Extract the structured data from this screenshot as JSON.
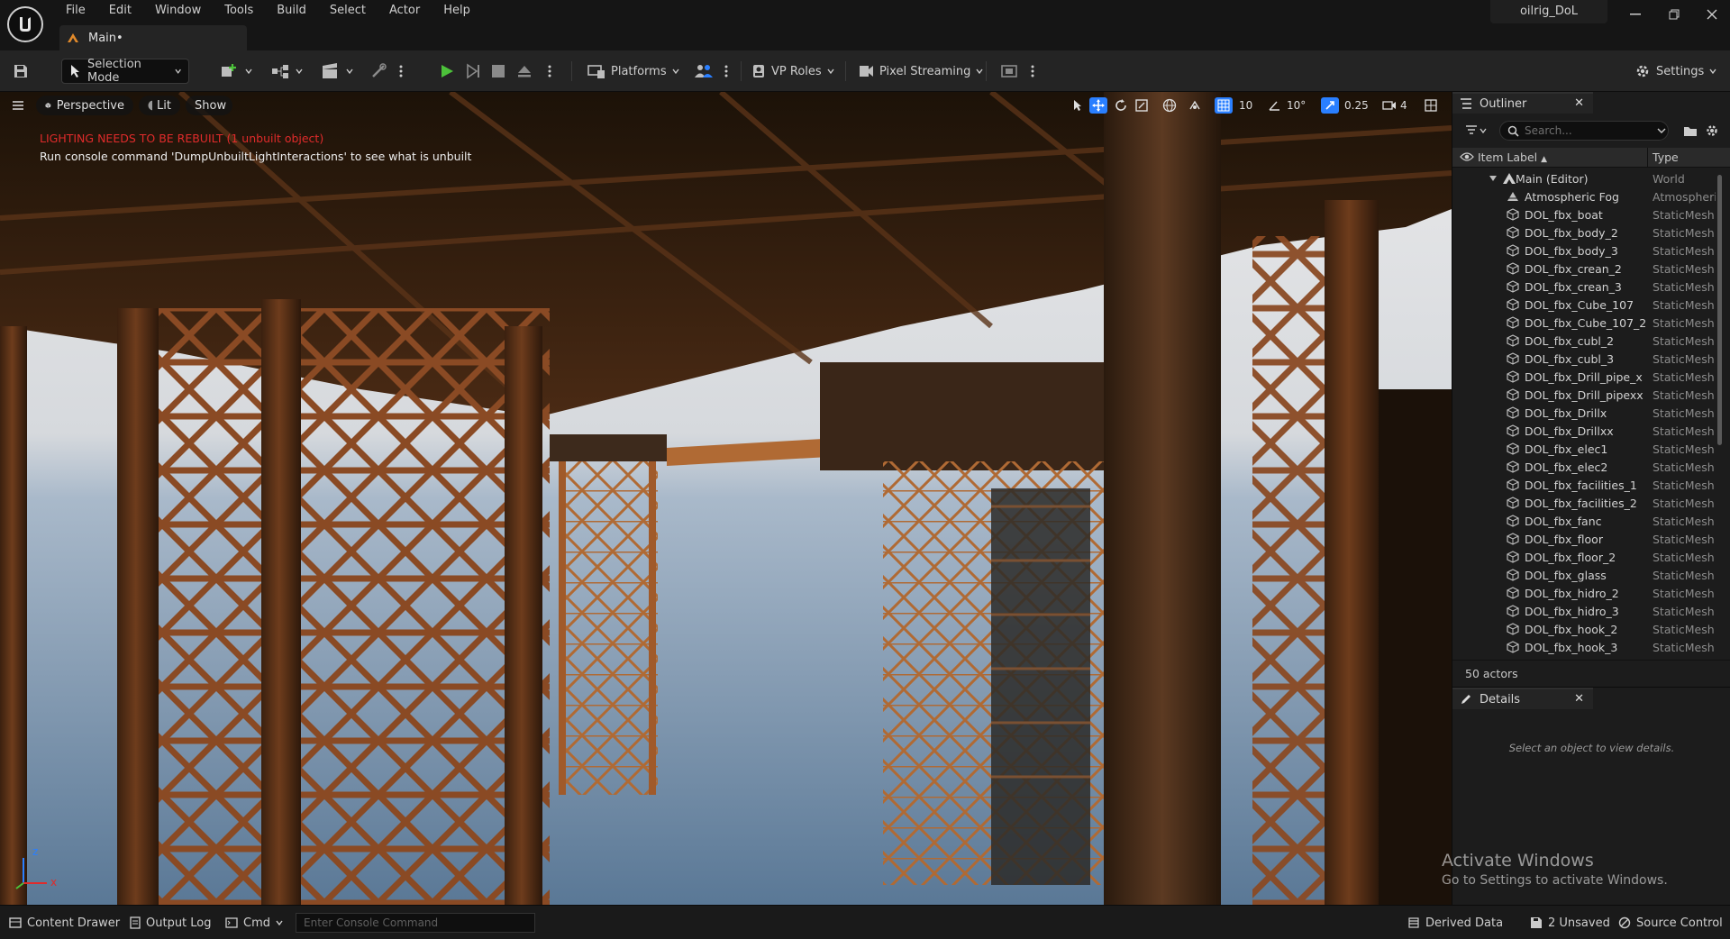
{
  "menu": [
    "File",
    "Edit",
    "Window",
    "Tools",
    "Build",
    "Select",
    "Actor",
    "Help"
  ],
  "document_tab": "Main•",
  "project_name": "oilrig_DoL",
  "toolbar": {
    "selection_mode": "Selection Mode",
    "platforms": "Platforms",
    "vp_roles": "VP Roles",
    "pixel_streaming": "Pixel Streaming",
    "settings": "Settings"
  },
  "viewport": {
    "perspective": "Perspective",
    "lit": "Lit",
    "show": "Show",
    "grid_snap": "10",
    "rotation_snap": "10°",
    "scale_snap": "0.25",
    "camera_speed": "4",
    "warning": "LIGHTING NEEDS TO BE REBUILT (1 unbuilt object)",
    "hint": "Run console command 'DumpUnbuiltLightInteractions' to see what is unbuilt",
    "axis_z": "z",
    "axis_x": "x"
  },
  "outliner": {
    "title": "Outliner",
    "search_placeholder": "Search...",
    "col_label": "Item Label",
    "col_type": "Type",
    "root": {
      "name": "Main (Editor)",
      "type": "World"
    },
    "items": [
      {
        "name": "Atmospheric Fog",
        "type": "Atmospheri"
      },
      {
        "name": "DOL_fbx_boat",
        "type": "StaticMesh"
      },
      {
        "name": "DOL_fbx_body_2",
        "type": "StaticMesh"
      },
      {
        "name": "DOL_fbx_body_3",
        "type": "StaticMesh"
      },
      {
        "name": "DOL_fbx_crean_2",
        "type": "StaticMesh"
      },
      {
        "name": "DOL_fbx_crean_3",
        "type": "StaticMesh"
      },
      {
        "name": "DOL_fbx_Cube_107",
        "type": "StaticMesh"
      },
      {
        "name": "DOL_fbx_Cube_107_2",
        "type": "StaticMesh"
      },
      {
        "name": "DOL_fbx_cubl_2",
        "type": "StaticMesh"
      },
      {
        "name": "DOL_fbx_cubl_3",
        "type": "StaticMesh"
      },
      {
        "name": "DOL_fbx_Drill_pipe_x",
        "type": "StaticMesh"
      },
      {
        "name": "DOL_fbx_Drill_pipexx",
        "type": "StaticMesh"
      },
      {
        "name": "DOL_fbx_Drillx",
        "type": "StaticMesh"
      },
      {
        "name": "DOL_fbx_Drillxx",
        "type": "StaticMesh"
      },
      {
        "name": "DOL_fbx_elec1",
        "type": "StaticMesh"
      },
      {
        "name": "DOL_fbx_elec2",
        "type": "StaticMesh"
      },
      {
        "name": "DOL_fbx_facilities_1",
        "type": "StaticMesh"
      },
      {
        "name": "DOL_fbx_facilities_2",
        "type": "StaticMesh"
      },
      {
        "name": "DOL_fbx_fanc",
        "type": "StaticMesh"
      },
      {
        "name": "DOL_fbx_floor",
        "type": "StaticMesh"
      },
      {
        "name": "DOL_fbx_floor_2",
        "type": "StaticMesh"
      },
      {
        "name": "DOL_fbx_glass",
        "type": "StaticMesh"
      },
      {
        "name": "DOL_fbx_hidro_2",
        "type": "StaticMesh"
      },
      {
        "name": "DOL_fbx_hidro_3",
        "type": "StaticMesh"
      },
      {
        "name": "DOL_fbx_hook_2",
        "type": "StaticMesh"
      },
      {
        "name": "DOL_fbx_hook_3",
        "type": "StaticMesh"
      }
    ],
    "actor_count": "50 actors"
  },
  "details": {
    "title": "Details",
    "empty": "Select an object to view details."
  },
  "watermark": {
    "line1": "Activate Windows",
    "line2": "Go to Settings to activate Windows."
  },
  "statusbar": {
    "content_drawer": "Content Drawer",
    "output_log": "Output Log",
    "cmd": "Cmd",
    "console_placeholder": "Enter Console Command",
    "derived_data": "Derived Data",
    "unsaved": "2 Unsaved",
    "source_control": "Source Control"
  },
  "colors": {
    "accent_blue": "#2a7fff",
    "play_green": "#4cc23a",
    "warning_red": "#e02b2b",
    "rust": "#8a4a24"
  }
}
